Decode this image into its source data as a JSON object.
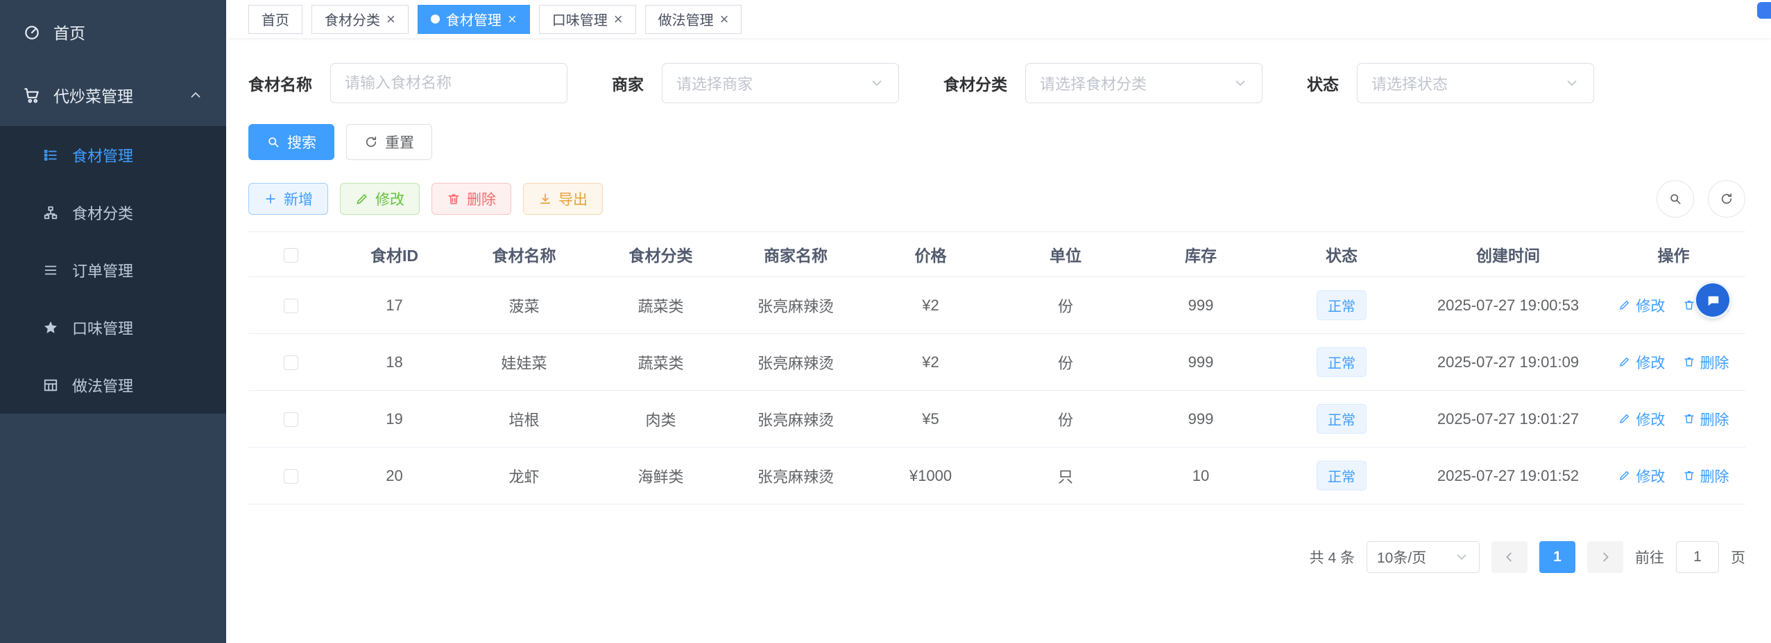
{
  "colors": {
    "accent": "#409eff",
    "sidebar_bg": "#304156",
    "submenu_bg": "#1f2d3d",
    "status_tag_bg": "#ecf5ff",
    "status_tag_text": "#409eff"
  },
  "sidebar": {
    "home": {
      "label": "首页"
    },
    "parent": {
      "label": "代炒菜管理"
    },
    "submenu": [
      {
        "label": "食材管理"
      },
      {
        "label": "食材分类"
      },
      {
        "label": "订单管理"
      },
      {
        "label": "口味管理"
      },
      {
        "label": "做法管理"
      }
    ]
  },
  "tabs": [
    {
      "label": "首页"
    },
    {
      "label": "食材分类"
    },
    {
      "label": "食材管理"
    },
    {
      "label": "口味管理"
    },
    {
      "label": "做法管理"
    }
  ],
  "ui": {
    "close_glyph": "×"
  },
  "filters": {
    "name_label": "食材名称",
    "name_placeholder": "请输入食材名称",
    "merchant_label": "商家",
    "merchant_placeholder": "请选择商家",
    "category_label": "食材分类",
    "category_placeholder": "请选择食材分类",
    "status_label": "状态",
    "status_placeholder": "请选择状态",
    "search_label": "搜索",
    "reset_label": "重置"
  },
  "toolbar": {
    "add_label": "新增",
    "edit_label": "修改",
    "delete_label": "删除",
    "export_label": "导出"
  },
  "table": {
    "headers": [
      "食材ID",
      "食材名称",
      "食材分类",
      "商家名称",
      "价格",
      "单位",
      "库存",
      "状态",
      "创建时间",
      "操作"
    ],
    "actions": {
      "edit": "修改",
      "delete": "删除"
    },
    "rows": [
      {
        "id": "17",
        "name": "菠菜",
        "category": "蔬菜类",
        "merchant": "张亮麻辣烫",
        "price": "¥2",
        "unit": "份",
        "stock": "999",
        "status": "正常",
        "created": "2025-07-27 19:00:53"
      },
      {
        "id": "18",
        "name": "娃娃菜",
        "category": "蔬菜类",
        "merchant": "张亮麻辣烫",
        "price": "¥2",
        "unit": "份",
        "stock": "999",
        "status": "正常",
        "created": "2025-07-27 19:01:09"
      },
      {
        "id": "19",
        "name": "培根",
        "category": "肉类",
        "merchant": "张亮麻辣烫",
        "price": "¥5",
        "unit": "份",
        "stock": "999",
        "status": "正常",
        "created": "2025-07-27 19:01:27"
      },
      {
        "id": "20",
        "name": "龙虾",
        "category": "海鲜类",
        "merchant": "张亮麻辣烫",
        "price": "¥1000",
        "unit": "只",
        "stock": "10",
        "status": "正常",
        "created": "2025-07-27 19:01:52"
      }
    ]
  },
  "pagination": {
    "total_text": "共 4 条",
    "page_size": "10条/页",
    "current_page": "1",
    "goto_prefix": "前往",
    "goto_value": "1",
    "goto_suffix": "页"
  }
}
